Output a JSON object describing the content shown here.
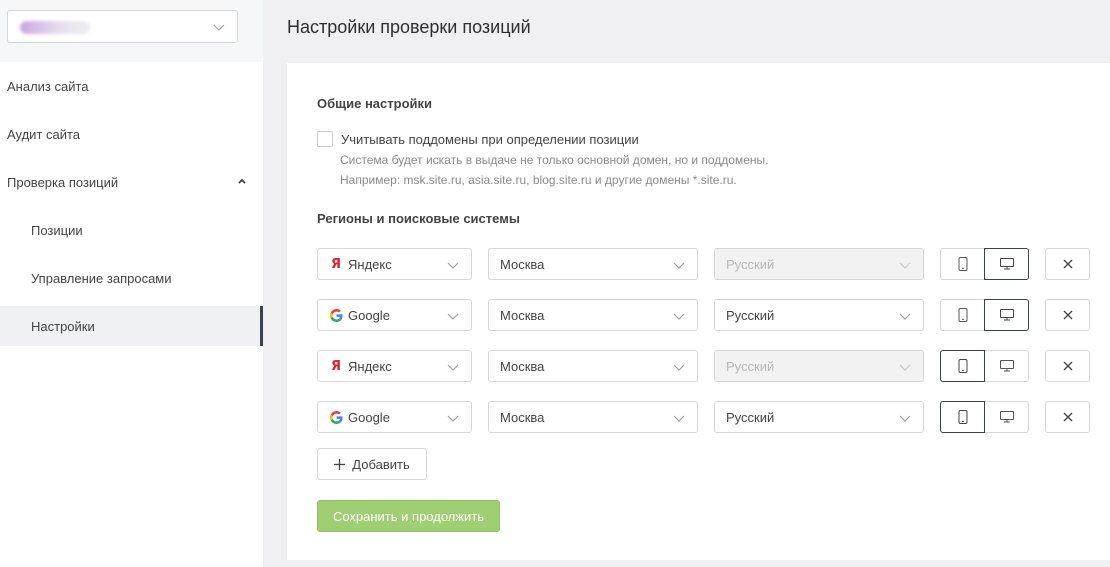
{
  "sidebar": {
    "project_name": "",
    "items": [
      {
        "label": "Анализ сайта"
      },
      {
        "label": "Аудит сайта"
      },
      {
        "label": "Проверка позиций"
      },
      {
        "label": "Позиции"
      },
      {
        "label": "Управление запросами"
      },
      {
        "label": "Настройки"
      }
    ]
  },
  "page": {
    "title": "Настройки проверки позиций"
  },
  "general": {
    "title": "Общие настройки",
    "subdomains_label": "Учитывать поддомены при определении позиции",
    "subdomains_checked": false,
    "hint_line1": "Система будет искать в выдаче не только основной домен, но и поддомены.",
    "hint_line2": "Например: msk.site.ru, asia.site.ru, blog.site.ru и другие домены *.site.ru."
  },
  "regions": {
    "title": "Регионы и поисковые системы",
    "rows": [
      {
        "engine": "Яндекс",
        "engine_icon": "yandex-icon",
        "region": "Москва",
        "language": "Русский",
        "language_disabled": true,
        "device": "desktop"
      },
      {
        "engine": "Google",
        "engine_icon": "google-icon",
        "region": "Москва",
        "language": "Русский",
        "language_disabled": false,
        "device": "desktop"
      },
      {
        "engine": "Яндекс",
        "engine_icon": "yandex-icon",
        "region": "Москва",
        "language": "Русский",
        "language_disabled": true,
        "device": "mobile"
      },
      {
        "engine": "Google",
        "engine_icon": "google-icon",
        "region": "Москва",
        "language": "Русский",
        "language_disabled": false,
        "device": "mobile"
      }
    ]
  },
  "actions": {
    "add_label": "Добавить",
    "save_label": "Сохранить и продолжить"
  },
  "colors": {
    "accent_dark": "#3a4150",
    "save_green": "#9fcf72",
    "yandex_red": "#e0212b"
  }
}
